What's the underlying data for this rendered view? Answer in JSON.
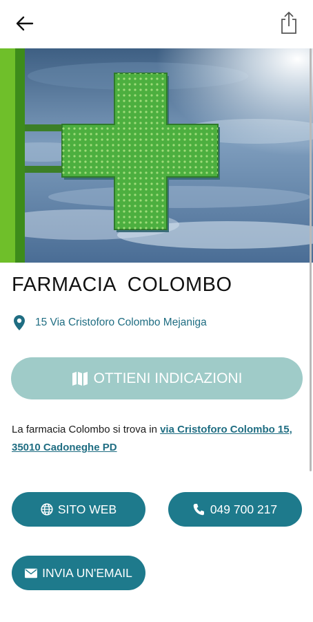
{
  "header": {
    "back_icon": "arrow-left-icon",
    "share_icon": "share-icon"
  },
  "hero": {
    "image": "green pharmacy cross sign against cloudy blue sky",
    "sign_color": "#4caf3f"
  },
  "pharmacy": {
    "name": "FARMACIA  COLOMBO",
    "address": "15 Via Cristoforo Colombo Mejaniga"
  },
  "directions": {
    "label": "OTTIENI INDICAZIONI",
    "icon": "map-icon"
  },
  "description": {
    "prefix": "La farmacia Colombo si trova in ",
    "link": "via Cristoforo Colombo 15, 35010 Cadoneghe PD"
  },
  "actions": {
    "website_label": "SITO WEB",
    "website_icon": "globe-icon",
    "phone_label": "049 700 217",
    "phone_icon": "phone-icon",
    "email_label": "INVIA UN'EMAIL",
    "email_icon": "envelope-icon"
  },
  "colors": {
    "primary": "#1e7a8c",
    "directions_button": "#9fcbc8",
    "link": "#1f6d82"
  }
}
